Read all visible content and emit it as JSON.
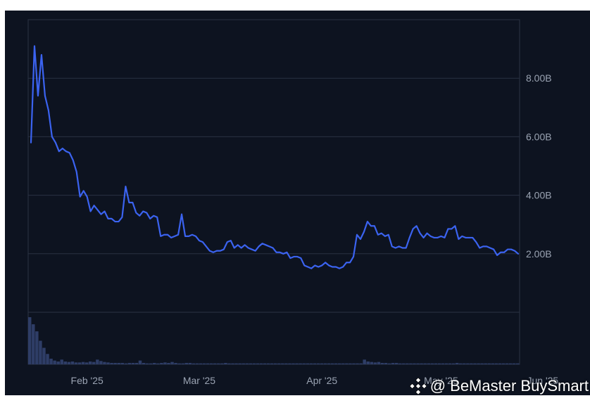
{
  "chart_data": {
    "type": "line",
    "title": "",
    "xlabel": "",
    "ylabel": "",
    "x_tick_labels": [
      "Feb '25",
      "Mar '25",
      "Apr '25",
      "May '25",
      "Jun '25"
    ],
    "y_tick_labels": [
      "2.00B",
      "4.00B",
      "6.00B",
      "8.00B"
    ],
    "y_tick_values": [
      2.0,
      4.0,
      6.0,
      8.0
    ],
    "unit": "billions",
    "ylim": [
      0,
      10.0
    ],
    "grid": true,
    "series": [
      {
        "values": [
          5.8,
          9.1,
          7.4,
          8.8,
          7.4,
          6.9,
          6.0,
          5.8,
          5.5,
          5.6,
          5.5,
          5.45,
          5.2,
          4.8,
          3.95,
          4.15,
          3.95,
          3.45,
          3.65,
          3.5,
          3.35,
          3.45,
          3.2,
          3.2,
          3.1,
          3.1,
          3.25,
          4.3,
          3.75,
          3.75,
          3.4,
          3.3,
          3.45,
          3.4,
          3.2,
          3.3,
          3.25,
          2.6,
          2.65,
          2.65,
          2.55,
          2.6,
          2.65,
          3.35,
          2.6,
          2.6,
          2.65,
          2.6,
          2.45,
          2.4,
          2.25,
          2.1,
          2.05,
          2.1,
          2.1,
          2.15,
          2.4,
          2.45,
          2.2,
          2.3,
          2.2,
          2.3,
          2.2,
          2.15,
          2.1,
          2.25,
          2.35,
          2.3,
          2.25,
          2.2,
          2.05,
          2.05,
          2.0,
          2.05,
          1.85,
          1.9,
          1.9,
          1.85,
          1.6,
          1.55,
          1.5,
          1.6,
          1.55,
          1.6,
          1.7,
          1.6,
          1.55,
          1.55,
          1.5,
          1.55,
          1.7,
          1.7,
          1.9,
          2.65,
          2.5,
          2.75,
          3.1,
          2.95,
          2.95,
          2.65,
          2.7,
          2.6,
          2.65,
          2.25,
          2.2,
          2.25,
          2.2,
          2.2,
          2.55,
          2.85,
          2.95,
          2.7,
          2.55,
          2.7,
          2.6,
          2.55,
          2.55,
          2.6,
          2.55,
          2.85,
          2.85,
          2.95,
          2.5,
          2.6,
          2.55,
          2.55,
          2.55,
          2.4,
          2.2,
          2.25,
          2.25,
          2.2,
          2.15,
          1.95,
          2.05,
          2.05,
          2.15,
          2.15,
          2.1,
          2.0
        ]
      }
    ],
    "volume": {
      "values": [
        1.0,
        0.85,
        0.7,
        0.5,
        0.35,
        0.22,
        0.12,
        0.08,
        0.06,
        0.1,
        0.06,
        0.05,
        0.06,
        0.04,
        0.04,
        0.05,
        0.04,
        0.06,
        0.05,
        0.1,
        0.07,
        0.05,
        0.04,
        0.03,
        0.03,
        0.03,
        0.03,
        0.02,
        0.03,
        0.03,
        0.03,
        0.08,
        0.03,
        0.02,
        0.02,
        0.03,
        0.02,
        0.03,
        0.04,
        0.03,
        0.05,
        0.03,
        0.02,
        0.02,
        0.03,
        0.03,
        0.02,
        0.02,
        0.02,
        0.02,
        0.02,
        0.02,
        0.02,
        0.02,
        0.02,
        0.03,
        0.02,
        0.02,
        0.02,
        0.02,
        0.02,
        0.02,
        0.02,
        0.02,
        0.02,
        0.02,
        0.02,
        0.02,
        0.02,
        0.02,
        0.02,
        0.02,
        0.02,
        0.02,
        0.02,
        0.02,
        0.02,
        0.02,
        0.02,
        0.02,
        0.02,
        0.02,
        0.02,
        0.02,
        0.02,
        0.02,
        0.02,
        0.02,
        0.02,
        0.02,
        0.02,
        0.02,
        0.02,
        0.02,
        0.1,
        0.06,
        0.05,
        0.04,
        0.05,
        0.03,
        0.03,
        0.02,
        0.03,
        0.03,
        0.02,
        0.02,
        0.02,
        0.02,
        0.02,
        0.02,
        0.02,
        0.02,
        0.02,
        0.02,
        0.02,
        0.02,
        0.02,
        0.02,
        0.02,
        0.02,
        0.03,
        0.02,
        0.02,
        0.02,
        0.02,
        0.02,
        0.02,
        0.02,
        0.02,
        0.02,
        0.02,
        0.02,
        0.02,
        0.02,
        0.02,
        0.02,
        0.02,
        0.02
      ]
    }
  },
  "colors": {
    "background": "#0d1320",
    "line": "#3b63f0",
    "grid": "#2a3343",
    "volume": "#2e3d66",
    "tick_text": "#9aa3b2"
  },
  "watermark": {
    "logo_icon": "binance-logo-icon",
    "text": "@ BeMaster BuySmart"
  }
}
